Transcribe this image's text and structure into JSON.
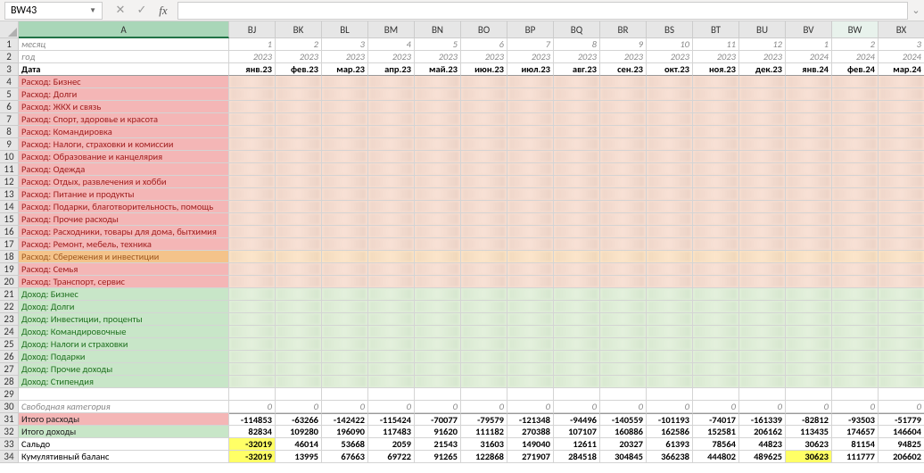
{
  "name_box": "BW43",
  "formula_value": "",
  "columns": [
    "A",
    "BJ",
    "BK",
    "BL",
    "BM",
    "BN",
    "BO",
    "BP",
    "BQ",
    "BR",
    "BS",
    "BT",
    "BU",
    "BV",
    "BW",
    "BX"
  ],
  "selected_col": "A",
  "active_col": "BW",
  "rows": {
    "1": {
      "label": "месяц",
      "type": "meta",
      "vals": [
        "1",
        "2",
        "3",
        "4",
        "5",
        "6",
        "7",
        "8",
        "9",
        "10",
        "11",
        "12",
        "1",
        "2",
        "3"
      ]
    },
    "2": {
      "label": "год",
      "type": "meta",
      "vals": [
        "2023",
        "2023",
        "2023",
        "2023",
        "2023",
        "2023",
        "2023",
        "2023",
        "2023",
        "2023",
        "2023",
        "2023",
        "2024",
        "2024",
        "2024"
      ]
    },
    "3": {
      "label": "Дата",
      "type": "hdr",
      "vals": [
        "янв.23",
        "фев.23",
        "мар.23",
        "апр.23",
        "май.23",
        "июн.23",
        "июл.23",
        "авг.23",
        "сен.23",
        "окт.23",
        "ноя.23",
        "дек.23",
        "янв.24",
        "фев.24",
        "мар.24"
      ]
    },
    "4": {
      "label": "Расход: Бизнес",
      "type": "expense"
    },
    "5": {
      "label": "Расход: Долги",
      "type": "expense"
    },
    "6": {
      "label": "Расход: ЖКХ и связь",
      "type": "expense"
    },
    "7": {
      "label": "Расход: Спорт, здоровье и красота",
      "type": "expense"
    },
    "8": {
      "label": "Расход: Командировка",
      "type": "expense"
    },
    "9": {
      "label": "Расход: Налоги, страховки и комиссии",
      "type": "expense"
    },
    "10": {
      "label": "Расход: Образование и канцелярия",
      "type": "expense"
    },
    "11": {
      "label": "Расход: Одежда",
      "type": "expense"
    },
    "12": {
      "label": "Расход: Отдых, развлечения и хобби",
      "type": "expense"
    },
    "13": {
      "label": "Расход: Питание и продукты",
      "type": "expense"
    },
    "14": {
      "label": "Расход: Подарки, благотворительность, помощь",
      "type": "expense"
    },
    "15": {
      "label": "Расход: Прочие расходы",
      "type": "expense"
    },
    "16": {
      "label": "Расход: Расходники, товары для дома, бытхимия",
      "type": "expense"
    },
    "17": {
      "label": "Расход: Ремонт, мебель, техника",
      "type": "expense"
    },
    "18": {
      "label": "Расход: Сбережения и инвестиции",
      "type": "expense-savings"
    },
    "19": {
      "label": "Расход: Семья",
      "type": "expense"
    },
    "20": {
      "label": "Расход: Транспорт, сервис",
      "type": "expense"
    },
    "21": {
      "label": "Доход: Бизнес",
      "type": "income"
    },
    "22": {
      "label": "Доход: Долги",
      "type": "income"
    },
    "23": {
      "label": "Доход: Инвестиции, проценты",
      "type": "income"
    },
    "24": {
      "label": "Доход: Командировочные",
      "type": "income"
    },
    "25": {
      "label": "Доход: Налоги и страховки",
      "type": "income"
    },
    "26": {
      "label": "Доход: Подарки",
      "type": "income"
    },
    "27": {
      "label": "Доход: Прочие доходы",
      "type": "income"
    },
    "28": {
      "label": "Доход: Стипендия",
      "type": "income"
    },
    "29": {
      "label": "",
      "type": "blank"
    },
    "30": {
      "label": "Свободная категория",
      "type": "free",
      "vals": [
        "0",
        "0",
        "0",
        "0",
        "0",
        "0",
        "0",
        "0",
        "0",
        "0",
        "0",
        "0",
        "0",
        "0",
        "0"
      ]
    },
    "31": {
      "label": "Итого расходы",
      "type": "total-exp",
      "vals": [
        "-114853",
        "-63266",
        "-142422",
        "-115424",
        "-70077",
        "-79579",
        "-121348",
        "-94496",
        "-140559",
        "-101193",
        "-74017",
        "-161339",
        "-82812",
        "-93503",
        "-51779"
      ]
    },
    "32": {
      "label": "Итого доходы",
      "type": "total-inc",
      "vals": [
        "82834",
        "109280",
        "196090",
        "117483",
        "91620",
        "111182",
        "270388",
        "107107",
        "160886",
        "162586",
        "152581",
        "206162",
        "113435",
        "174657",
        "146604"
      ]
    },
    "33": {
      "label": "Сальдо",
      "type": "saldo",
      "vals": [
        "-32019",
        "46014",
        "53668",
        "2059",
        "21543",
        "31603",
        "149040",
        "12611",
        "20327",
        "61393",
        "78564",
        "44823",
        "30623",
        "81154",
        "94825"
      ],
      "hl": [
        0
      ]
    },
    "34": {
      "label": "Кумулятивный баланс",
      "type": "cumul",
      "vals": [
        "-32019",
        "13995",
        "67663",
        "69722",
        "91265",
        "122868",
        "271907",
        "284518",
        "304845",
        "366238",
        "444802",
        "489625",
        "30623",
        "111777",
        "206602"
      ],
      "hl": [
        0,
        12
      ]
    }
  },
  "row_order": [
    "1",
    "2",
    "3",
    "4",
    "5",
    "6",
    "7",
    "8",
    "9",
    "10",
    "11",
    "12",
    "13",
    "14",
    "15",
    "16",
    "17",
    "18",
    "19",
    "20",
    "21",
    "22",
    "23",
    "24",
    "25",
    "26",
    "27",
    "28",
    "29",
    "30",
    "31",
    "32",
    "33",
    "34"
  ]
}
